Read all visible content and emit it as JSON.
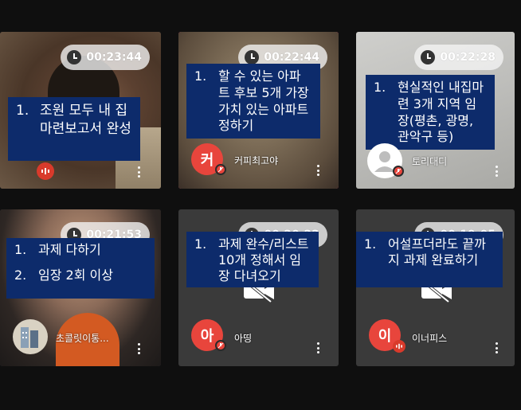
{
  "theme": {
    "page_bg": "#0f0f0f",
    "note_bg": "#0d2b6b",
    "avatar_red": "#e8453c",
    "active_border": "#e53170",
    "mic_off_red": "#e8453c",
    "speaking_red": "#d93a2b"
  },
  "tiles": [
    {
      "id": "t1",
      "timer": "00:23:44",
      "notes": [
        {
          "num": "1.",
          "text": "조원 모두 내 집마련보고서 완성"
        }
      ],
      "participant": {
        "name": "",
        "avatar_letter": "",
        "status": "speaking"
      }
    },
    {
      "id": "t2",
      "timer": "00:22:44",
      "notes": [
        {
          "num": "1.",
          "text": "할 수 있는 아파트 후보 5개 가장 가치 있는 아파트 정하기"
        }
      ],
      "participant": {
        "name": "커피최고야",
        "avatar_letter": "커",
        "status": "muted"
      }
    },
    {
      "id": "t3",
      "timer": "00:22:28",
      "notes": [
        {
          "num": "1.",
          "text": "현실적인 내집마련 3개 지역 임장(평촌, 광명, 관악구 등)"
        }
      ],
      "participant": {
        "name": "토리대디",
        "avatar_letter": "",
        "status": "muted"
      }
    },
    {
      "id": "t4",
      "timer": "00:21:53",
      "notes": [
        {
          "num": "1.",
          "text": "과제 다하기"
        },
        {
          "num": "2.",
          "text": "임장 2회 이상"
        }
      ],
      "participant": {
        "name": "초콜릿이통...",
        "avatar_letter": "",
        "status": "none"
      }
    },
    {
      "id": "t5",
      "timer": "00:20:22",
      "notes": [
        {
          "num": "1.",
          "text": "과제 완수/리스트 10개 정해서 임장 다녀오기"
        }
      ],
      "participant": {
        "name": "아띵",
        "avatar_letter": "아",
        "status": "muted"
      }
    },
    {
      "id": "t6",
      "timer": "00:19:05",
      "notes": [
        {
          "num": "1.",
          "text": "어설프더라도 끝까지 과제 완료하기"
        }
      ],
      "participant": {
        "name": "이너피스",
        "avatar_letter": "이",
        "status": "speaking"
      }
    }
  ]
}
